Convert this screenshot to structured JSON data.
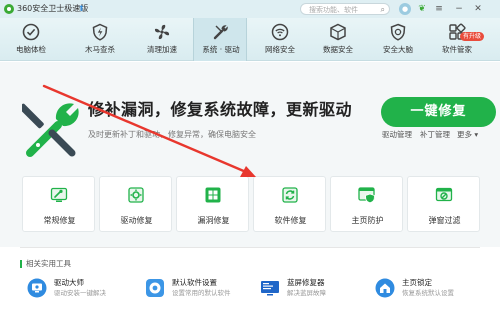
{
  "app": {
    "title": "360安全卫士极速版",
    "search_placeholder": "搜索功能、软件"
  },
  "titlebar_icons": [
    "update-arrow-icon",
    "search-icon",
    "avatar-icon",
    "leaf-icon",
    "menu-icon",
    "minimize-icon",
    "close-icon"
  ],
  "nav": {
    "items": [
      {
        "label": "电脑体检",
        "icon": "check-icon"
      },
      {
        "label": "木马查杀",
        "icon": "bolt-icon"
      },
      {
        "label": "清理加速",
        "icon": "fan-icon"
      },
      {
        "label": "系统 · 驱动",
        "icon": "wrench-icon",
        "active": true
      },
      {
        "label": "网络安全",
        "icon": "wifi-icon"
      },
      {
        "label": "数据安全",
        "icon": "shield-data-icon"
      },
      {
        "label": "安全大脑",
        "icon": "brain-icon"
      },
      {
        "label": "软件管家",
        "icon": "grid-icon",
        "badge": "有升级"
      }
    ]
  },
  "hero": {
    "title": "修补漏洞，修复系统故障，更新驱动",
    "subtitle": "及时更新补丁和驱动，修复异常，确保电脑安全",
    "button_label": "一键修复",
    "links": [
      "驱动管理",
      "补丁管理",
      "更多 ▾"
    ]
  },
  "cards": [
    {
      "label": "常规修复",
      "icon": "routine-repair-icon"
    },
    {
      "label": "驱动修复",
      "icon": "driver-repair-icon"
    },
    {
      "label": "漏洞修复",
      "icon": "windows-patch-icon"
    },
    {
      "label": "软件修复",
      "icon": "software-repair-icon"
    },
    {
      "label": "主页防护",
      "icon": "homepage-protect-icon"
    },
    {
      "label": "弹窗过滤",
      "icon": "popup-filter-icon"
    }
  ],
  "utils": {
    "heading": "相关实用工具",
    "items": [
      {
        "title": "驱动大师",
        "desc": "驱动安装一键解决",
        "icon": "driver-master-icon"
      },
      {
        "title": "默认软件设置",
        "desc": "设置常用的默认软件",
        "icon": "default-software-icon"
      },
      {
        "title": "蓝屏修复器",
        "desc": "解决蓝屏故障",
        "icon": "bluescreen-fix-icon"
      },
      {
        "title": "主页锁定",
        "desc": "恢复系统默认设置",
        "icon": "homepage-lock-icon"
      }
    ]
  },
  "colors": {
    "accent_green": "#21b24a",
    "nav_bg": "#dfeff3",
    "annotation_red": "#e8372e"
  }
}
